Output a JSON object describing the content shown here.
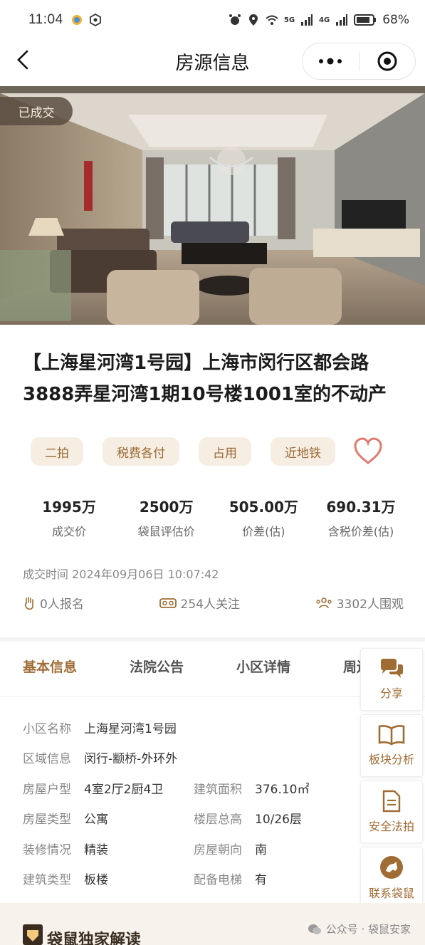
{
  "status_bar": {
    "time": "11:04",
    "network_5g": "5G",
    "network_4g": "4G",
    "battery": "68%"
  },
  "nav": {
    "title": "房源信息"
  },
  "hero": {
    "badge": "已成交"
  },
  "property": {
    "title": "【上海星河湾1号园】上海市闵行区都会路3888弄星河湾1期10号楼1001室的不动产"
  },
  "tags": [
    "二拍",
    "税费各付",
    "占用",
    "近地铁"
  ],
  "stats": [
    {
      "value": "1995万",
      "label": "成交价"
    },
    {
      "value": "2500万",
      "label": "袋鼠评估价"
    },
    {
      "value": "505.00万",
      "label": "价差(估)"
    },
    {
      "value": "690.31万",
      "label": "含税价差(估)"
    }
  ],
  "deal_time": "成交时间 2024年09月06日 10:07:42",
  "meta": {
    "signup": "0人报名",
    "follow": "254人关注",
    "viewers": "3302人围观"
  },
  "tabs": [
    "基本信息",
    "法院公告",
    "小区详情",
    "周边"
  ],
  "info": {
    "community_k": "小区名称",
    "community_v": "上海星河湾1号园",
    "area_k": "区域信息",
    "area_v": "闵行-颛桥-外环外",
    "layout_k": "房屋户型",
    "layout_v": "4室2厅2厨4卫",
    "size_k": "建筑面积",
    "size_v": "376.10㎡",
    "type_k": "房屋类型",
    "type_v": "公寓",
    "floor_k": "楼层总高",
    "floor_v": "10/26层",
    "decor_k": "装修情况",
    "decor_v": "精装",
    "orient_k": "房屋朝向",
    "orient_v": "南",
    "building_k": "建筑类型",
    "building_v": "板楼",
    "elevator_k": "配备电梯",
    "elevator_v": "有"
  },
  "float_buttons": [
    "分享",
    "板块分析",
    "安全法拍",
    "联系袋鼠"
  ],
  "bottom": {
    "heading": "袋鼠独家解读",
    "watermark": "公众号 · 袋鼠安家"
  },
  "colors": {
    "accent": "#a06c33",
    "tag_bg": "#f6eee3",
    "heart": "#e07b6f"
  }
}
